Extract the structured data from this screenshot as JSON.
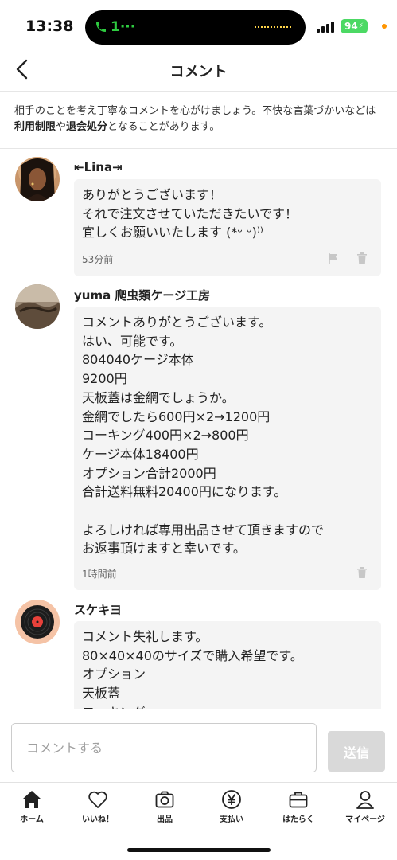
{
  "status_bar": {
    "time": "13:38",
    "call_indicator": "1···",
    "battery": "94"
  },
  "header": {
    "title": "コメント",
    "back_icon": "chevron-left-icon"
  },
  "notice": {
    "part1": "相手のことを考え丁寧なコメントを心がけましょう。不快な言葉づかいなどは",
    "bold1": "利用制限",
    "part2": "や",
    "bold2": "退会処分",
    "part3": "となることがあります。"
  },
  "comments": [
    {
      "username": "⇤Lina⇥",
      "text": "ありがとうございます！\nそれで注文させていただきたいです！\n宜しくお願いいたします (*ᵕ ᵕ)⁾⁾",
      "time": "53分前"
    },
    {
      "username": "yuma 爬虫類ケージ工房",
      "text": "コメントありがとうございます。\nはい、可能です。\n804040ケージ本体\n9200円\n天板蓋は金網でしょうか。\n金網でしたら600円×2→1200円\nコーキング400円×2→800円\nケージ本体18400円\nオプション合計2000円\n合計送料無料20400円になります。\n\nよろしければ専用出品させて頂きますので\nお返事頂けますと幸いです。",
      "time": "1時間前"
    },
    {
      "username": "スケキヨ",
      "text": "コメント失礼します。\n80×40×40のサイズで購入希望です。\nオプション\n天板蓋\nコーキング"
    }
  ],
  "input": {
    "placeholder": "コメントする",
    "send_label": "送信"
  },
  "tab_bar": [
    {
      "label": "ホーム",
      "icon": "home-icon"
    },
    {
      "label": "いいね！",
      "icon": "heart-icon"
    },
    {
      "label": "出品",
      "icon": "camera-icon"
    },
    {
      "label": "支払い",
      "icon": "yen-icon"
    },
    {
      "label": "はたらく",
      "icon": "briefcase-icon"
    },
    {
      "label": "マイページ",
      "icon": "person-icon"
    }
  ],
  "colors": {
    "bubble_bg": "#f4f4f4",
    "send_button_bg": "#d9d9d9",
    "battery": "#4cd964",
    "call_green": "#2ecc40"
  }
}
